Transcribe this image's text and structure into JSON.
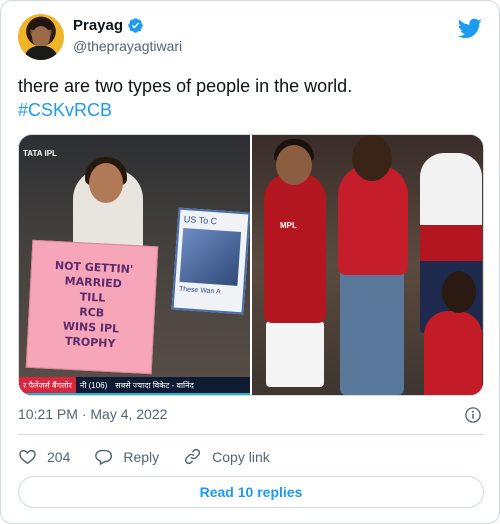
{
  "author": {
    "display_name": "Prayag",
    "handle": "@theprayagtiwari",
    "verified": true
  },
  "tweet": {
    "text": "there are two types of people in the world.",
    "hashtag": "#CSKvRCB",
    "timestamp": "10:21 PM · May 4, 2022"
  },
  "media": {
    "left_image": {
      "broadcast_logo": "TATA IPL",
      "sign_lines": [
        "NOT GETTIN'",
        "MARRIED",
        "TILL",
        "RCB",
        "WINS IPL",
        "TROPHY"
      ],
      "sign_small": "US To C",
      "sign_small_caption": "These Wan A",
      "ticker_left": "र पैलेंजर्स बैंगलोर",
      "ticker_mid": "नी (106)",
      "ticker_right": "सबसे ज्यादा विकेट - वानिंद"
    },
    "right_image": {
      "jersey_text": "MPL"
    }
  },
  "actions": {
    "like_count": "204",
    "reply_label": "Reply",
    "copy_label": "Copy link"
  },
  "read_replies_label": "Read 10 replies",
  "colors": {
    "accent": "#1d9bf0",
    "secondary_text": "#536471",
    "border": "#cfd9de"
  }
}
